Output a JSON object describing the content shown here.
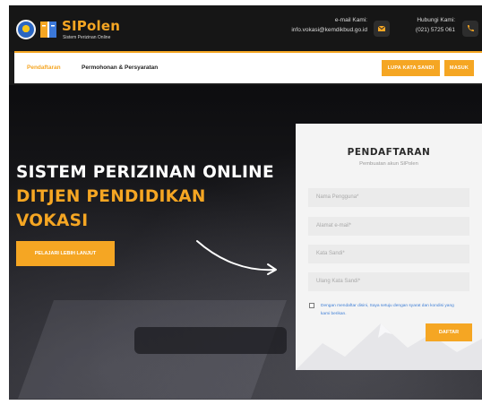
{
  "brand": {
    "name": "SIPolen",
    "tagline": "Sistem Perizinan Online",
    "icon_emblem": "ministry-emblem",
    "icon_book": "book-logo"
  },
  "contact": {
    "email_label": "e-mail Kami:",
    "email_value": "info.vokasi@kemdikbud.go.id",
    "email_icon": "envelope-icon",
    "phone_label": "Hubungi Kami:",
    "phone_value": "(021) 5725 061",
    "phone_icon": "phone-icon"
  },
  "nav": {
    "links": [
      "Pendaftaran",
      "Permohonan & Persyaratan"
    ],
    "active_index": 0,
    "forgot_button": "LUPA KATA SANDI",
    "login_button": "MASUK"
  },
  "hero": {
    "line1": "SISTEM PERIZINAN ONLINE",
    "line2": "DITJEN PENDIDIKAN",
    "line3": "VOKASI",
    "cta": "PELAJARI LEBIH LANJUT"
  },
  "register": {
    "title": "PENDAFTARAN",
    "subtitle": "Pembuatan akun SIPolen",
    "fields": {
      "username_placeholder": "Nama Pengguna*",
      "email_placeholder": "Alamat e-mail*",
      "password_placeholder": "Kata Sandi*",
      "confirm_placeholder": "Ulang Kata Sandi*"
    },
    "agree_text": "Dengan mendaftar disini, Saya setuju dengan syarat dan kondisi yang kami berikan.",
    "agree_checked": false,
    "submit": "DAFTAR"
  },
  "colors": {
    "accent": "#f5a623",
    "dark": "#161616",
    "card": "#f4f4f4",
    "link": "#3f7fd6"
  }
}
